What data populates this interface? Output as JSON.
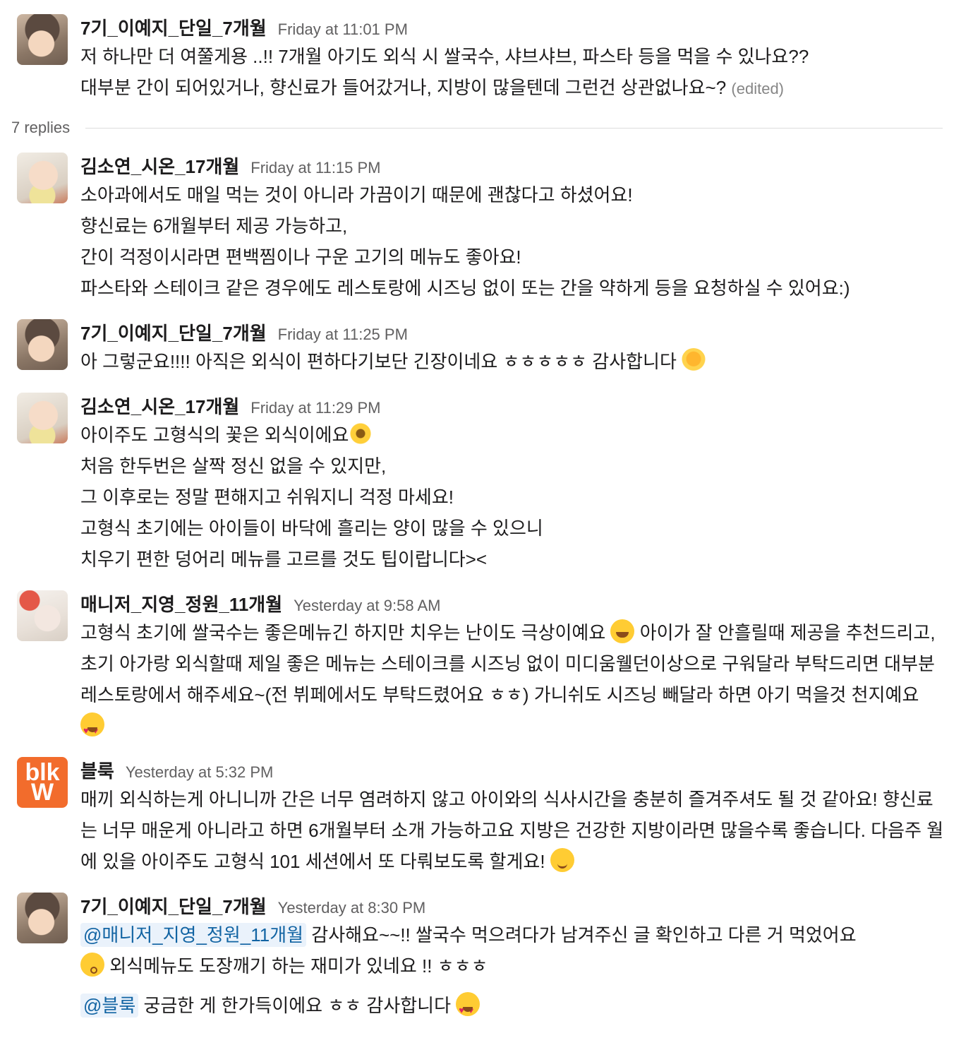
{
  "replies_label": "7 replies",
  "messages": [
    {
      "author": "7기_이예지_단일_7개월",
      "time": "Friday at 11:01 PM",
      "lines": [
        "저 하나만 더 여쭐게용 ..!! 7개월 아기도 외식 시 쌀국수, 샤브샤브, 파스타 등을 먹을 수 있나요??",
        "대부분 간이 되어있거나, 향신료가 들어갔거나, 지방이 많을텐데 그런건 상관없나요~?"
      ],
      "edited": "(edited)"
    },
    {
      "author": "김소연_시온_17개월",
      "time": "Friday at 11:15 PM",
      "lines": [
        "소아과에서도 매일 먹는 것이 아니라 가끔이기 때문에 괜찮다고 하셨어요!",
        "향신료는 6개월부터 제공 가능하고,",
        "간이 걱정이시라면 편백찜이나 구운 고기의 메뉴도 좋아요!",
        "파스타와 스테이크 같은 경우에도 레스토랑에 시즈닝 없이 또는 간을 약하게 등을 요청하실 수 있어요:)"
      ]
    },
    {
      "author": "7기_이예지_단일_7개월",
      "time": "Friday at 11:25 PM",
      "lines": [
        "아 그렇군요!!!! 아직은 외식이 편하다기보단 긴장이네요 ㅎㅎㅎㅎㅎ 감사합니다 "
      ]
    },
    {
      "author": "김소연_시온_17개월",
      "time": "Friday at 11:29 PM",
      "lines": [
        "아이주도 고형식의 꽃은 외식이에요",
        "처음 한두번은 살짝 정신 없을 수 있지만,",
        "그 이후로는 정말 편해지고 쉬워지니 걱정 마세요!",
        "고형식 초기에는 아이들이 바닥에 흘리는 양이 많을 수 있으니",
        "치우기 편한 덩어리 메뉴를 고르를 것도 팁이랍니다><"
      ]
    },
    {
      "author": "매니저_지영_정원_11개월",
      "time": "Yesterday at 9:58 AM",
      "text_a": "고형식 초기에 쌀국수는 좋은메뉴긴 하지만 치우는 난이도 극상이예요 ",
      "text_b": "  아이가 잘 안흘릴때 제공을 추천드리고, 초기 아가랑 외식할때 제일 좋은 메뉴는 스테이크를 시즈닝 없이 미디움웰던이상으로 구워달라 부탁드리면 대부분 레스토랑에서 해주세요~(전 뷔페에서도 부탁드렸어요 ㅎㅎ) 가니쉬도 시즈닝 빼달라 하면 아기 먹을것 천지예요 "
    },
    {
      "author": "블룩",
      "time": "Yesterday at 5:32 PM",
      "text": "매끼 외식하는게 아니니까 간은 너무 염려하지 않고 아이와의 식사시간을 충분히 즐겨주셔도 될 것 같아요! 향신료는 너무 매운게 아니라고 하면 6개월부터 소개 가능하고요 지방은 건강한 지방이라면 많을수록 좋습니다. 다음주 월에 있을 아이주도 고형식 101 세션에서 또 다뤄보도록 할게요! "
    },
    {
      "author": "7기_이예지_단일_7개월",
      "time": "Yesterday at 8:30 PM",
      "mention1": "@매니저_지영_정원_11개월",
      "text1": " 감사해요~~!! 쌀국수 먹으려다가 남겨주신 글 확인하고 다른 거 먹었어요",
      "text2": " 외식메뉴도 도장깨기 하는 재미가 있네요 !! ㅎㅎㅎ",
      "mention2": "@블룩",
      "text3": " 궁금한 게 한가득이에요 ㅎㅎ 감사합니다 "
    }
  ],
  "avatars": {
    "blook_logo_top": "blk",
    "blook_logo_bottom": "W"
  },
  "colors": {
    "mention_bg": "#eaf2fb",
    "mention_fg": "#1264a3",
    "blook_orange": "#f26c2c"
  }
}
